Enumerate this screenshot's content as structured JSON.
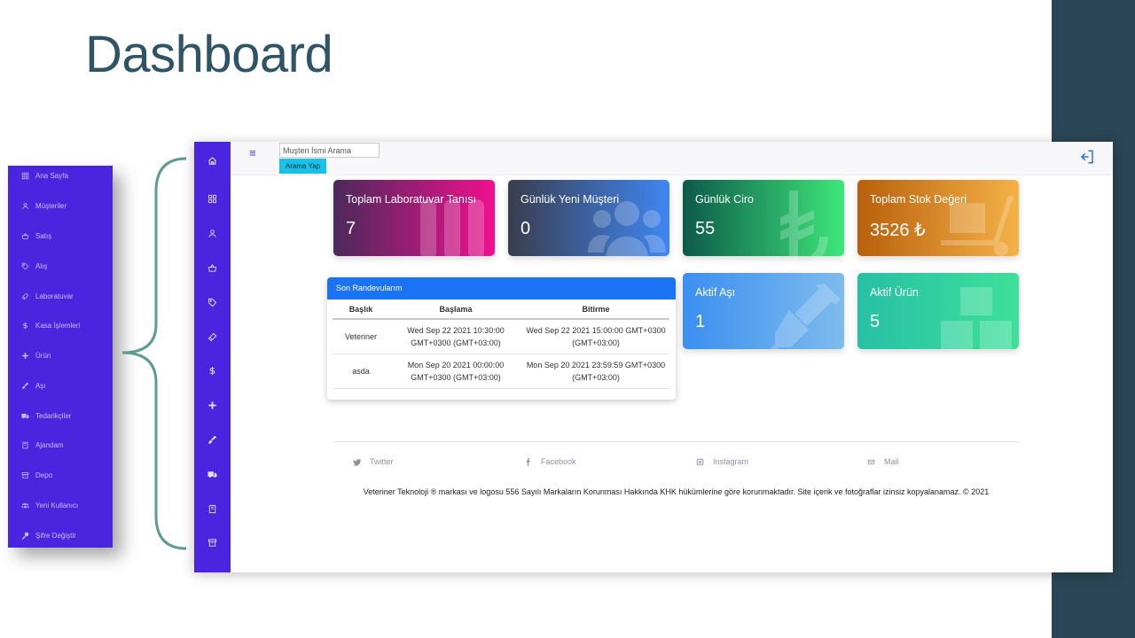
{
  "slide": {
    "title": "Dashboard"
  },
  "colors": {
    "sidebar": "#4a25e0",
    "band": "#2b4656",
    "title": "#2f5466",
    "brace": "#5f9a93"
  },
  "expanded_sidebar": {
    "items": [
      {
        "label": "Ana Sayfa",
        "icon": "grid-icon"
      },
      {
        "label": "Müşteriler",
        "icon": "user-icon"
      },
      {
        "label": "Satış",
        "icon": "basket-icon"
      },
      {
        "label": "Alış",
        "icon": "tag-icon"
      },
      {
        "label": "Laboratuvar",
        "icon": "test-tube-icon"
      },
      {
        "label": "Kasa İşlemleri",
        "icon": "dollar-icon"
      },
      {
        "label": "Ürün",
        "icon": "plus-icon"
      },
      {
        "label": "Aşı",
        "icon": "syringe-icon"
      },
      {
        "label": "Tedarikçiler",
        "icon": "truck-icon"
      },
      {
        "label": "Ajandam",
        "icon": "book-icon"
      },
      {
        "label": "Depo",
        "icon": "archive-icon"
      },
      {
        "label": "Yeni Kullanıcı",
        "icon": "users-icon"
      },
      {
        "label": "Şifre Değiştir",
        "icon": "key-icon"
      }
    ]
  },
  "app": {
    "search": {
      "placeholder": "Muşteri İsmi Arama",
      "button": "Arama Yap"
    },
    "cards": [
      {
        "title": "Toplam Laboratuvar Tanısı",
        "value": "7",
        "icon": "test-tubes-icon",
        "colors": [
          "#4a2a5a",
          "#f0108e"
        ]
      },
      {
        "title": "Günlük Yeni Müşteri",
        "value": "0",
        "icon": "users-icon",
        "colors": [
          "#3a3d4e",
          "#3f86f2"
        ]
      },
      {
        "title": "Günlük Ciro",
        "value": "55",
        "icon": "lira-icon",
        "colors": [
          "#0c5a4a",
          "#3ee77a"
        ]
      },
      {
        "title": "Toplam Stok Değeri",
        "value": "3526 ₺",
        "icon": "dolly-icon",
        "colors": [
          "#b8600c",
          "#f5b247"
        ]
      },
      {
        "title": "Aktif Aşı",
        "value": "1",
        "icon": "syringe-icon",
        "colors": [
          "#3b8ff0",
          "#7dbbec"
        ]
      },
      {
        "title": "Aktif Ürün",
        "value": "5",
        "icon": "boxes-icon",
        "colors": [
          "#27c0a5",
          "#3ee09a"
        ]
      }
    ],
    "appointments": {
      "header": "Son Randevularım",
      "columns": [
        "Başlık",
        "Başlama",
        "Bitirme"
      ],
      "rows": [
        [
          "Veteriner",
          "Wed Sep 22 2021 10:30:00 GMT+0300 (GMT+03:00)",
          "Wed Sep 22 2021 15:00:00 GMT+0300 (GMT+03:00)"
        ],
        [
          "asda",
          "Mon Sep 20 2021 00:00:00 GMT+0300 (GMT+03:00)",
          "Mon Sep 20 2021 23:59:59 GMT+0300 (GMT+03:00)"
        ]
      ]
    },
    "footer": {
      "social": [
        "Twitter",
        "Facebook",
        "Instagram",
        "Mail"
      ],
      "copyright": "Veteriner Teknoloji ® markası ve logosu 556 Sayılı Markaların Korunması Hakkında KHK hükümlerine göre korunmaktadır. Site içerik ve fotoğraflar izinsiz kopyalanamaz. © 2021"
    }
  }
}
